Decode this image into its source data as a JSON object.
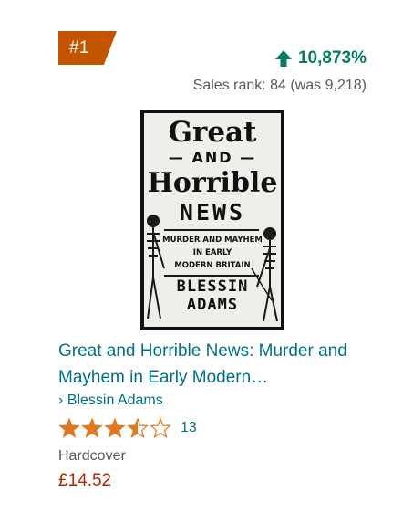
{
  "badge": {
    "rank": "#1"
  },
  "movement": {
    "percent": "10,873%",
    "direction": "up",
    "color": "#067d62"
  },
  "sales_rank": {
    "text": "Sales rank: 84 (was 9,218)"
  },
  "cover": {
    "line1": "Great",
    "line2": "— AND —",
    "line3": "Horrible",
    "line4": "NEWS",
    "subtitle1": "MURDER AND MAYHEM",
    "subtitle2": "IN EARLY",
    "subtitle3": "MODERN BRITAIN",
    "author1": "BLESSIN",
    "author2": "ADAMS"
  },
  "product": {
    "title": "Great and Horrible News: Murder and Mayhem in Early Modern…",
    "author": "› Blessin Adams",
    "rating": 3.5,
    "rating_count": "13",
    "format": "Hardcover",
    "price": "£14.52"
  },
  "colors": {
    "badge": "#c45500",
    "link": "#007185",
    "price": "#b12704",
    "star": "#de7921"
  }
}
